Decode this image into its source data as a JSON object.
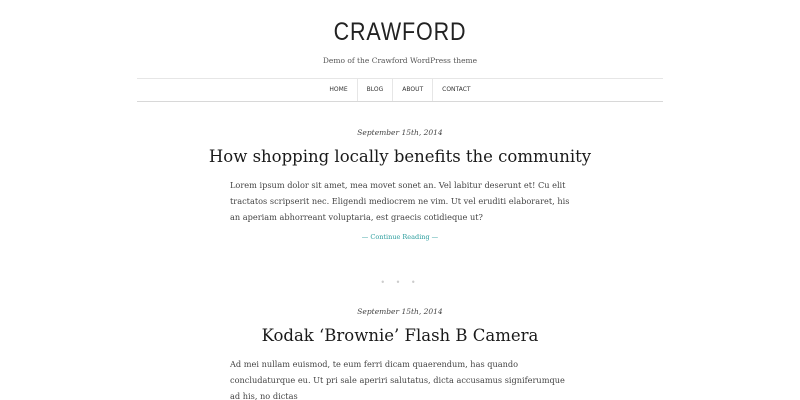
{
  "site": {
    "title": "CRAWFORD",
    "description": "Demo of the Crawford WordPress theme"
  },
  "nav": {
    "items": [
      "HOME",
      "BLOG",
      "ABOUT",
      "CONTACT"
    ]
  },
  "posts": [
    {
      "date": "September 15th, 2014",
      "title": "How shopping locally benefits the community",
      "excerpt": "Lorem ipsum dolor sit amet, mea movet sonet an. Vel labitur deserunt et! Cu elit tractatos scripserit nec. Eligendi mediocrem ne vim. Ut vel eruditi elaboraret, his an aperiam abhorreant voluptaria, est graecis cotidieque ut?",
      "read_more": "— Continue Reading —"
    },
    {
      "date": "September 15th, 2014",
      "title": "Kodak ‘Brownie’ Flash B Camera",
      "excerpt": "Ad mei nullam euismod, te eum ferri dicam quaerendum, has quando concludaturque eu. Ut pri sale aperiri salutatus, dicta accusamus signiferumque ad his, no dictas"
    }
  ],
  "separator": "• • •"
}
